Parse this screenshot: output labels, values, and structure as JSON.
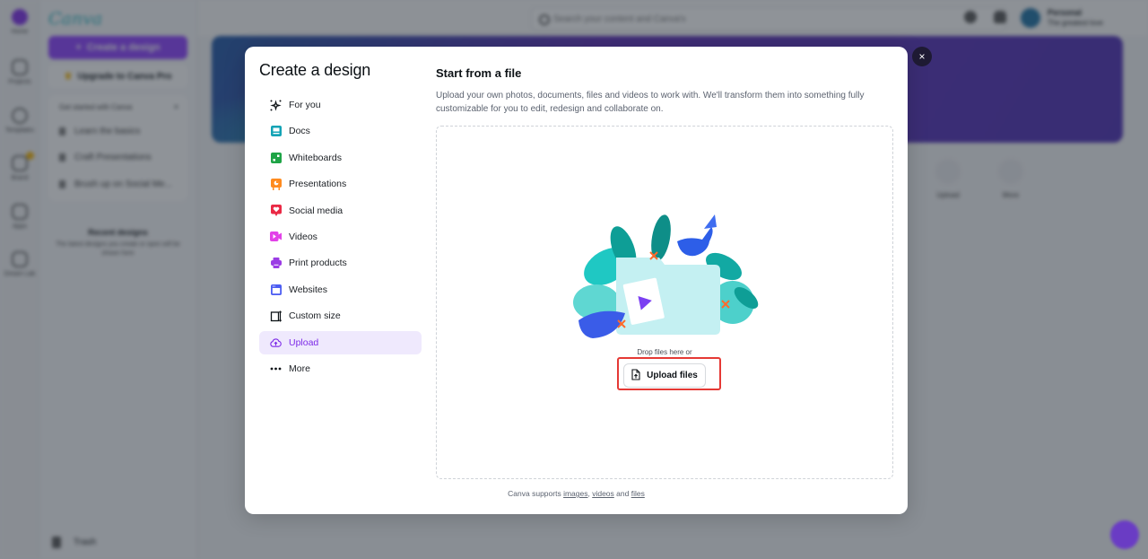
{
  "background": {
    "rail": [
      {
        "label": "Home",
        "icon": "home-icon",
        "active": true
      },
      {
        "label": "Projects",
        "icon": "folder-icon"
      },
      {
        "label": "Templates",
        "icon": "templates-icon"
      },
      {
        "label": "Brand",
        "icon": "brand-icon",
        "badge": true
      },
      {
        "label": "Apps",
        "icon": "apps-icon"
      },
      {
        "label": "Dream Lab",
        "icon": "dream-lab-icon"
      }
    ],
    "sidebar": {
      "logo": "Canva",
      "create_button": "Create a design",
      "upgrade_button": "Upgrade to Canva Pro",
      "get_started": {
        "heading": "Get started with Canva",
        "items": [
          "Learn the basics",
          "Craft Presentations",
          "Brush up on Social Me..."
        ]
      },
      "recent": {
        "title": "Recent designs",
        "description": "The latest designs you create or open will be shown here"
      },
      "trash": "Trash"
    },
    "topbar": {
      "search_placeholder": "Search your content and Canva's",
      "account_name": "Personal",
      "account_plan": "The greatest love"
    },
    "quick_actions": [
      "Upload",
      "More"
    ]
  },
  "modal": {
    "title": "Create a design",
    "close_label": "×",
    "nav": [
      {
        "label": "For you",
        "icon": "sparkle-icon",
        "color": "#0d1216"
      },
      {
        "label": "Docs",
        "icon": "docs-icon",
        "color": "#13a3b5"
      },
      {
        "label": "Whiteboards",
        "icon": "whiteboard-icon",
        "color": "#1ea446"
      },
      {
        "label": "Presentations",
        "icon": "presentation-icon",
        "color": "#ff8b1f"
      },
      {
        "label": "Social media",
        "icon": "heart-icon",
        "color": "#ea2945"
      },
      {
        "label": "Videos",
        "icon": "video-icon",
        "color": "#e241e8"
      },
      {
        "label": "Print products",
        "icon": "printer-icon",
        "color": "#9b3ce5"
      },
      {
        "label": "Websites",
        "icon": "website-icon",
        "color": "#4c5df2"
      },
      {
        "label": "Custom size",
        "icon": "custom-size-icon",
        "color": "#0d1216"
      },
      {
        "label": "Upload",
        "icon": "cloud-upload-icon",
        "color": "#7d2ae8",
        "active": true
      },
      {
        "label": "More",
        "icon": "more-icon",
        "color": "#0d1216"
      }
    ],
    "pane": {
      "title": "Start from a file",
      "description": "Upload your own photos, documents, files and videos to work with. We'll transform them into something fully customizable for you to edit, redesign and collaborate on.",
      "drop_text": "Drop files here or",
      "upload_button": "Upload files",
      "supports_prefix": "Canva supports ",
      "supports_links": [
        "images",
        "videos",
        "files"
      ],
      "supports_sep1": ", ",
      "supports_sep2": " and "
    }
  },
  "colors": {
    "accent": "#8b3dff",
    "active_text": "#7d2ae8",
    "active_bg": "#efe9fd",
    "highlight": "#e53935"
  }
}
